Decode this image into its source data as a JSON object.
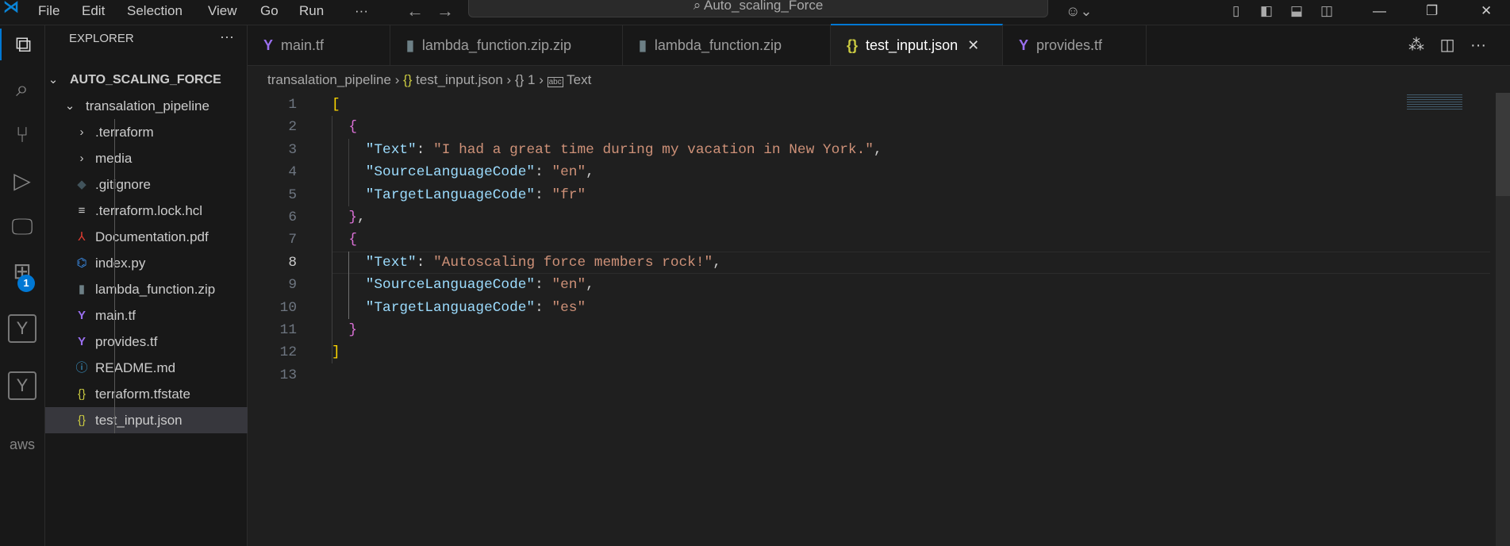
{
  "titlebar": {
    "menus": [
      "File",
      "Edit",
      "Selection",
      "View",
      "Go",
      "Run",
      "···"
    ],
    "search": "Auto_scaling_Force"
  },
  "activity": {
    "badge": "1",
    "aws": "aws"
  },
  "sidebar": {
    "title": "EXPLORER",
    "more": "···",
    "root": "AUTO_SCALING_FORCE",
    "items": [
      {
        "label": "transalation_pipeline",
        "kind": "folder-open",
        "depth": 1
      },
      {
        "label": ".terraform",
        "kind": "folder",
        "depth": 2
      },
      {
        "label": "media",
        "kind": "folder",
        "depth": 2
      },
      {
        "label": ".gitignore",
        "kind": "git",
        "depth": 2
      },
      {
        "label": ".terraform.lock.hcl",
        "kind": "lines",
        "depth": 2
      },
      {
        "label": "Documentation.pdf",
        "kind": "pdf",
        "depth": 2
      },
      {
        "label": "index.py",
        "kind": "python",
        "depth": 2
      },
      {
        "label": "lambda_function.zip",
        "kind": "zip",
        "depth": 2
      },
      {
        "label": "main.tf",
        "kind": "terraform",
        "depth": 2
      },
      {
        "label": "provides.tf",
        "kind": "terraform",
        "depth": 2
      },
      {
        "label": "README.md",
        "kind": "info",
        "depth": 2
      },
      {
        "label": "terraform.tfstate",
        "kind": "json",
        "depth": 2
      },
      {
        "label": "test_input.json",
        "kind": "json",
        "depth": 2,
        "selected": true
      }
    ]
  },
  "tabs": [
    {
      "label": "main.tf",
      "kind": "terraform"
    },
    {
      "label": "lambda_function.zip.zip",
      "kind": "zip"
    },
    {
      "label": "lambda_function.zip",
      "kind": "zip"
    },
    {
      "label": "test_input.json",
      "kind": "json",
      "active": true
    },
    {
      "label": "provides.tf",
      "kind": "terraform"
    }
  ],
  "breadcrumb": {
    "folder": "transalation_pipeline",
    "file": "test_input.json",
    "node": "1",
    "field": "Text"
  },
  "editor": {
    "current_line": 8,
    "lines": [
      [
        [
          "by",
          "["
        ]
      ],
      [
        [
          "p",
          "  "
        ],
        [
          "bp",
          "{"
        ]
      ],
      [
        [
          "p",
          "    "
        ],
        [
          "k",
          "\"Text\""
        ],
        [
          "p",
          ": "
        ],
        [
          "s",
          "\"I had a great time during my vacation in New York.\""
        ],
        [
          "p",
          ","
        ]
      ],
      [
        [
          "p",
          "    "
        ],
        [
          "k",
          "\"SourceLanguageCode\""
        ],
        [
          "p",
          ": "
        ],
        [
          "s",
          "\"en\""
        ],
        [
          "p",
          ","
        ]
      ],
      [
        [
          "p",
          "    "
        ],
        [
          "k",
          "\"TargetLanguageCode\""
        ],
        [
          "p",
          ": "
        ],
        [
          "s",
          "\"fr\""
        ]
      ],
      [
        [
          "p",
          "  "
        ],
        [
          "bp",
          "}"
        ],
        [
          "p",
          ","
        ]
      ],
      [
        [
          "p",
          "  "
        ],
        [
          "bp",
          "{"
        ]
      ],
      [
        [
          "p",
          "    "
        ],
        [
          "k",
          "\"Text\""
        ],
        [
          "p",
          ": "
        ],
        [
          "s",
          "\"Autoscaling force members rock!\""
        ],
        [
          "p",
          ","
        ]
      ],
      [
        [
          "p",
          "    "
        ],
        [
          "k",
          "\"SourceLanguageCode\""
        ],
        [
          "p",
          ": "
        ],
        [
          "s",
          "\"en\""
        ],
        [
          "p",
          ","
        ]
      ],
      [
        [
          "p",
          "    "
        ],
        [
          "k",
          "\"TargetLanguageCode\""
        ],
        [
          "p",
          ": "
        ],
        [
          "s",
          "\"es\""
        ]
      ],
      [
        [
          "p",
          "  "
        ],
        [
          "bp",
          "}"
        ]
      ],
      [
        [
          "by",
          "]"
        ]
      ],
      []
    ]
  }
}
